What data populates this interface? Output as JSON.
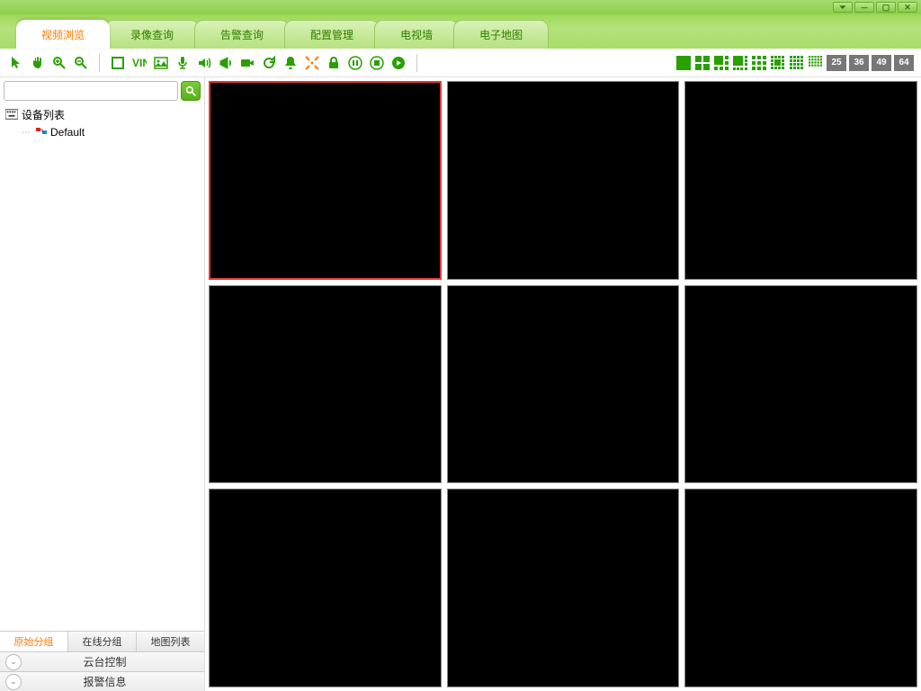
{
  "tabs": {
    "active": "视频浏览",
    "items": [
      "视频浏览",
      "录像查询",
      "告警查询",
      "配置管理",
      "电视墙",
      "电子地图"
    ]
  },
  "grid_numbers": [
    "25",
    "36",
    "49",
    "64"
  ],
  "sidebar": {
    "placeholder": "",
    "root": "设备列表",
    "child": "Default",
    "tabs": [
      "原始分组",
      "在线分组",
      "地图列表"
    ],
    "panels": [
      "云台控制",
      "报警信息"
    ]
  }
}
